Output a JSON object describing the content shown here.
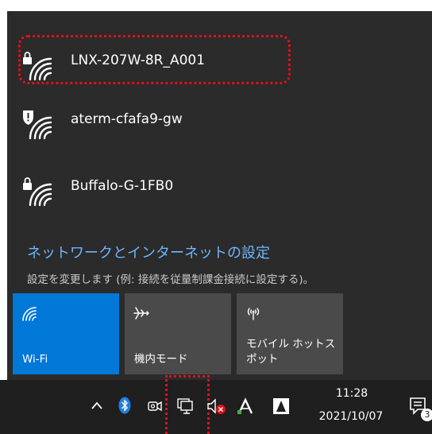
{
  "networks": [
    {
      "ssid": "LNX-207W-8R_A001",
      "status": "secured",
      "icon": "wifi-lock-icon"
    },
    {
      "ssid": "aterm-cfafa9-gw",
      "status": "warning",
      "icon": "wifi-shield-icon"
    },
    {
      "ssid": "Buffalo-G-1FB0",
      "status": "secured",
      "icon": "wifi-lock-icon"
    }
  ],
  "settings": {
    "link_label": "ネットワークとインターネットの設定",
    "description": "設定を変更します (例: 接続を従量制課金接続に設定する)。"
  },
  "quick_actions": {
    "wifi": {
      "label": "Wi-Fi",
      "icon": "wifi-icon",
      "active": true
    },
    "airplane": {
      "label": "機内モード",
      "icon": "airplane-icon",
      "active": false
    },
    "hotspot": {
      "label": "モバイル ホットス\nポット",
      "icon": "hotspot-icon",
      "active": false
    }
  },
  "taskbar": {
    "time": "11:28",
    "date": "2021/10/07",
    "notification_count": "3",
    "icons": [
      "chevron-up-icon",
      "bluetooth-icon",
      "camera-icon",
      "network-icon",
      "volume-muted-icon",
      "font-a-icon",
      "adobe-icon",
      "notification-icon"
    ]
  },
  "colors": {
    "panel_bg": "#2b2b2b",
    "accent": "#0078d7",
    "link": "#6fb6ff",
    "highlight": "#e0101d",
    "taskbar_bg": "#1f1f1f"
  }
}
